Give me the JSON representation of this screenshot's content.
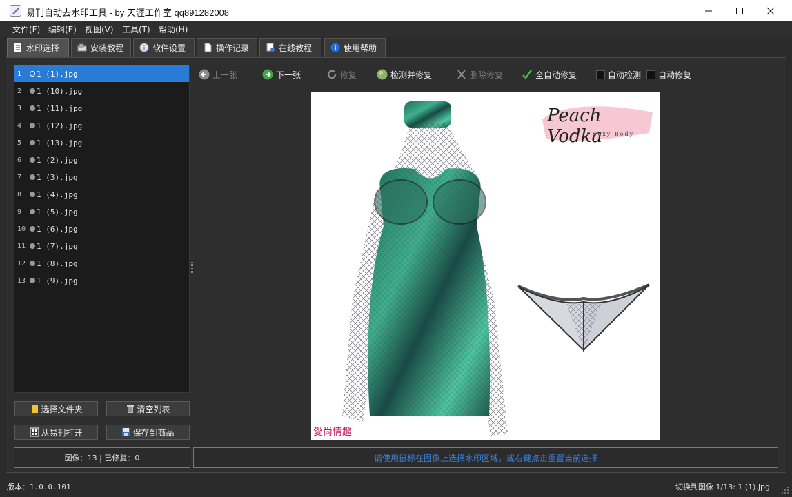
{
  "window": {
    "title": "易刊自动去水印工具 - by 天涯工作室 qq891282008"
  },
  "menu": [
    "文件(F)",
    "编辑(E)",
    "视图(V)",
    "工具(T)",
    "帮助(H)"
  ],
  "tabs": [
    {
      "label": "水印选择",
      "icon": "document-icon",
      "active": true
    },
    {
      "label": "安装教程",
      "icon": "package-icon",
      "active": false
    },
    {
      "label": "软件设置",
      "icon": "info-icon",
      "active": false
    },
    {
      "label": "操作记录",
      "icon": "page-icon",
      "active": false
    },
    {
      "label": "在线教程",
      "icon": "online-icon",
      "active": false
    },
    {
      "label": "使用帮助",
      "icon": "info-circle-icon",
      "active": false
    }
  ],
  "files": [
    {
      "num": "1",
      "name": "1 (1).jpg",
      "selected": true
    },
    {
      "num": "2",
      "name": "1 (10).jpg",
      "selected": false
    },
    {
      "num": "3",
      "name": "1 (11).jpg",
      "selected": false
    },
    {
      "num": "4",
      "name": "1 (12).jpg",
      "selected": false
    },
    {
      "num": "5",
      "name": "1 (13).jpg",
      "selected": false
    },
    {
      "num": "6",
      "name": "1 (2).jpg",
      "selected": false
    },
    {
      "num": "7",
      "name": "1 (3).jpg",
      "selected": false
    },
    {
      "num": "8",
      "name": "1 (4).jpg",
      "selected": false
    },
    {
      "num": "9",
      "name": "1 (5).jpg",
      "selected": false
    },
    {
      "num": "10",
      "name": "1 (6).jpg",
      "selected": false
    },
    {
      "num": "11",
      "name": "1 (7).jpg",
      "selected": false
    },
    {
      "num": "12",
      "name": "1 (8).jpg",
      "selected": false
    },
    {
      "num": "13",
      "name": "1 (9).jpg",
      "selected": false
    }
  ],
  "left_buttons": {
    "select_folder": "选择文件夹",
    "clear_list": "清空列表",
    "open_from_yikan": "从易刊打开",
    "save_to_product": "保存到商品"
  },
  "toolbar": {
    "prev": "上一张",
    "next": "下一张",
    "repair": "修复",
    "detect_repair": "检测并修复",
    "delete_repair": "删除修复",
    "auto_repair_all": "全自动修复",
    "auto_detect": "自动检测",
    "auto_repair": "自动修复"
  },
  "preview": {
    "brand_logo_text": "Peach Vodka",
    "brand_logo_sub": "Sexy Body",
    "watermark_text": "愛尚情趣"
  },
  "stats": {
    "text": "图像：13 | 已修复：0"
  },
  "hint": {
    "text": "请使用鼠标在图像上选择水印区域，或右键点击重置当前选择"
  },
  "status": {
    "version": "版本：1.0.0.101",
    "current": "切换到图像 1/13: 1 (1).jpg"
  },
  "colors": {
    "selection": "#2a7bd6",
    "hint_text": "#3c7fd8",
    "background": "#2b2b2b"
  }
}
